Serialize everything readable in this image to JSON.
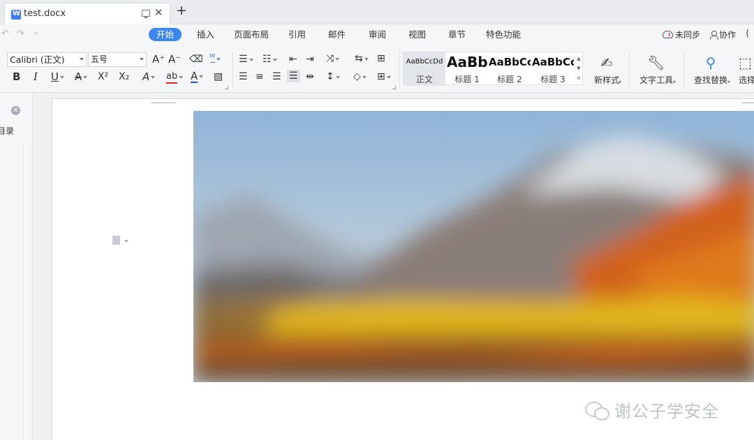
{
  "tab": {
    "title": "test.docx",
    "new_tab": "+"
  },
  "menu": {
    "items": [
      "开始",
      "插入",
      "页面布局",
      "引用",
      "邮件",
      "审阅",
      "视图",
      "章节",
      "特色功能"
    ],
    "sync_label": "未同步",
    "collab_label": "协作"
  },
  "ribbon": {
    "font_name": "Calibri (正文)",
    "font_size": "五号",
    "styles": [
      {
        "sample": "AaBbCcDd",
        "name": "正文"
      },
      {
        "sample": "AaBb",
        "name": "标题 1"
      },
      {
        "sample": "AaBbCc",
        "name": "标题 2"
      },
      {
        "sample": "AaBbCc",
        "name": "标题 3"
      }
    ],
    "new_style_label": "新样式",
    "text_tools_label": "文字工具",
    "find_replace_label": "查找替换",
    "select_label": "选择"
  },
  "nav": {
    "toc_label": "目录"
  },
  "watermark": {
    "text": "谢公子学安全"
  },
  "icons": [
    "undo-icon",
    "redo-icon",
    "customize-icon",
    "cloud-sync-icon",
    "collab-icon",
    "paste-options-icon"
  ]
}
